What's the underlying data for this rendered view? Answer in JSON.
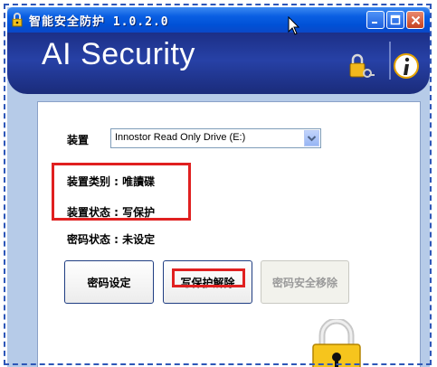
{
  "window": {
    "title": "智能安全防护 1.0.2.0",
    "controls": {
      "minimize": "_",
      "maximize": "□",
      "close": "X"
    }
  },
  "header": {
    "brand": "AI Security",
    "icons": [
      "key-lock-icon",
      "info-icon"
    ]
  },
  "form": {
    "device_label": "装置",
    "device_value": "Innostor Read Only Drive (E:)",
    "device_type_label": "装置类别 : 唯讀碟",
    "device_state_label": "装置状态 : 写保护",
    "password_state_label": "密码状态 : 未设定"
  },
  "buttons": {
    "set_password": "密码设定",
    "remove_write_protect": "写保护解除",
    "remove_password_security": "密码安全移除"
  },
  "colors": {
    "highlight": "#e02020",
    "title_bar": "#0a5fe3",
    "header_bg": "#1c2f86"
  }
}
